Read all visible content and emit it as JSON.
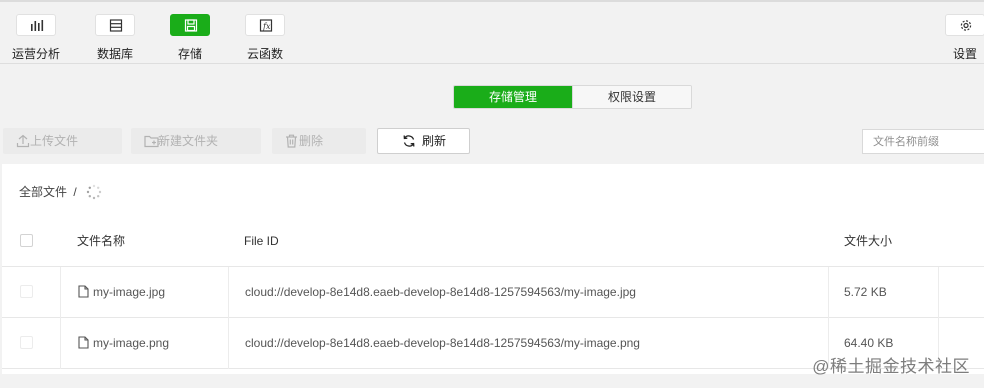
{
  "toolbar": {
    "items": [
      {
        "label": "运营分析",
        "icon": "bar-chart-icon"
      },
      {
        "label": "数据库",
        "icon": "database-icon"
      },
      {
        "label": "存储",
        "icon": "storage-icon",
        "active": true
      },
      {
        "label": "云函数",
        "icon": "function-icon"
      }
    ],
    "settings_label": "设置",
    "accent_color": "#1aad19"
  },
  "tabs": [
    {
      "label": "存储管理",
      "active": true
    },
    {
      "label": "权限设置",
      "active": false
    }
  ],
  "actions": {
    "upload": "上传文件",
    "new_folder": "新建文件夹",
    "delete": "删除",
    "refresh": "刷新"
  },
  "search": {
    "placeholder": "文件名称前缀"
  },
  "breadcrumb": {
    "root": "全部文件",
    "separator": "/"
  },
  "table": {
    "headers": [
      "文件名称",
      "File ID",
      "文件大小"
    ],
    "rows": [
      {
        "name": "my-image.jpg",
        "file_id": "cloud://develop-8e14d8.eaeb-develop-8e14d8-1257594563/my-image.jpg",
        "size": "5.72 KB"
      },
      {
        "name": "my-image.png",
        "file_id": "cloud://develop-8e14d8.eaeb-develop-8e14d8-1257594563/my-image.png",
        "size": "64.40 KB"
      }
    ]
  },
  "watermark": "@稀土掘金技术社区"
}
